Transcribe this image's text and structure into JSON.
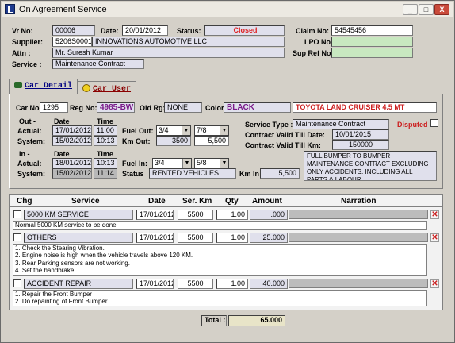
{
  "window": {
    "title": "On Agreement Service",
    "min": "_",
    "max": "□",
    "close": "X"
  },
  "header": {
    "vr_no_label": "Vr No:",
    "vr_no": "00006",
    "date_label": "Date:",
    "date": "20/01/2012",
    "status_label": "Status:",
    "status": "Closed",
    "claim_label": "Claim No:",
    "claim_no": "54545456",
    "supplier_label": "Supplier:",
    "supplier_code": "5206S0001",
    "supplier_name": "INNOVATIONS AUTOMOTIVE LLC",
    "lpo_label": "LPO No:",
    "lpo_no": "",
    "attn_label": "Attn :",
    "attn": "Mr. Suresh Kumar",
    "supref_label": "Sup Ref No:",
    "supref": "",
    "service_label": "Service :",
    "service": "Maintenance Contract"
  },
  "tabs": [
    {
      "label": "Car Detail"
    },
    {
      "label": "Car User"
    }
  ],
  "car": {
    "carno_label": "Car No:",
    "carno": "1295",
    "regno_label": "Reg No:",
    "regno": "4985-BW",
    "oldrg_label": "Old Rg:",
    "oldrg": "NONE",
    "color_label": "Color",
    "color": "BLACK",
    "model": "TOYOTA LAND CRUISER 4.5 MT",
    "out_label": "Out -",
    "date_h": "Date",
    "time_h": "Time",
    "actual_label": "Actual:",
    "system_label": "System:",
    "out_actual_date": "17/01/2012",
    "out_actual_time": "11:00",
    "out_sys_date": "15/02/2012",
    "out_sys_time": "10:13",
    "fuel_out_label": "Fuel Out:",
    "fuel_out_1": "3/4",
    "fuel_out_2": "7/8",
    "km_out_label": "Km Out:",
    "km_out_1": "3500",
    "km_out_2": "5,500",
    "in_label": "In -",
    "in_actual_date": "18/01/2012",
    "in_actual_time": "10:13",
    "in_sys_date": "15/02/2012",
    "in_sys_time": "11:14",
    "fuel_in_label": "Fuel In:",
    "fuel_in_1": "3/4",
    "fuel_in_2": "5/8",
    "status_label": "Status",
    "status_val": "RENTED VEHICLES",
    "km_in_label": "Km In",
    "km_in": "5,500",
    "service_type_label": "Service Type :",
    "service_type": "Maintenance Contract",
    "disputed_label": "Disputed",
    "valid_date_label": "Contract Valid Till  Date:",
    "valid_date": "10/01/2015",
    "valid_km_label": "Contract Valid Till Km:",
    "valid_km": "150000",
    "remark": "FULL BUMPER TO BUMPER MAINTENANCE CONTRACT EXCLUDING ONLY ACCIDENTS. INCLUDING ALL PARTS & LABOUR"
  },
  "grid": {
    "headers": [
      "Chg",
      "Service",
      "Date",
      "Ser. Km",
      "Qty",
      "Amount",
      "Narration"
    ],
    "rows": [
      {
        "service": "5000 KM SERVICE",
        "date": "17/01/2012",
        "km": "5500",
        "qty": "1.00",
        "amount": ".000",
        "notes": [
          "Normal 5000 KM service to be done"
        ]
      },
      {
        "service": "OTHERS",
        "date": "17/01/2012",
        "km": "5500",
        "qty": "1.00",
        "amount": "25.000",
        "notes": [
          "1. Check the Stearing Vibration.",
          "2. Engine noise is high when the vehicle travels above 120 KM.",
          "3. Rear Parking sensors are not working.",
          "4. Set the handbrake"
        ]
      },
      {
        "service": "ACCIDENT REPAIR",
        "date": "17/01/2012",
        "km": "5500",
        "qty": "1.00",
        "amount": "40.000",
        "notes": [
          "1. Repair the Front Bumper",
          "2. Do repainting of Front Bumper"
        ]
      }
    ],
    "total_label": "Total :",
    "total": "65.000"
  },
  "colors": {
    "status": "#e02020",
    "purple": "#7a1a8a",
    "green": "#c8e8c0",
    "red": "#cc2020"
  }
}
